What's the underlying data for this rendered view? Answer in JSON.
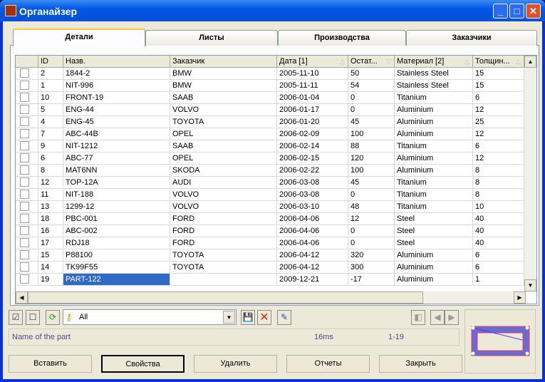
{
  "window": {
    "title": "Органайзер"
  },
  "tabs": [
    "Детали",
    "Листы",
    "Производства",
    "Заказчики"
  ],
  "columns": [
    {
      "label": "ID"
    },
    {
      "label": "Назв."
    },
    {
      "label": "Заказчик"
    },
    {
      "label": "Дата [1]",
      "sort": "asc"
    },
    {
      "label": "Остат...",
      "sort": "desc"
    },
    {
      "label": "Материал [2]",
      "sort": "asc"
    },
    {
      "label": "Толщин...",
      "sort": "asc"
    }
  ],
  "rows": [
    [
      "2",
      "1844-2",
      "BMW",
      "2005-11-10",
      "50",
      "Stainless Steel",
      "15"
    ],
    [
      "1",
      "NIT-996",
      "BMW",
      "2005-11-11",
      "54",
      "Stainless Steel",
      "15"
    ],
    [
      "10",
      "FRONT-19",
      "SAAB",
      "2006-01-04",
      "0",
      "Titanium",
      "6"
    ],
    [
      "5",
      "ENG-44",
      "VOLVO",
      "2006-01-17",
      "0",
      "Aluminium",
      "12"
    ],
    [
      "4",
      "ENG-45",
      "TOYOTA",
      "2006-01-20",
      "45",
      "Aluminium",
      "25"
    ],
    [
      "7",
      "ABC-44B",
      "OPEL",
      "2006-02-09",
      "100",
      "Aluminium",
      "12"
    ],
    [
      "9",
      "NIT-1212",
      "SAAB",
      "2006-02-14",
      "88",
      "Titanium",
      "6"
    ],
    [
      "6",
      "ABC-77",
      "OPEL",
      "2006-02-15",
      "120",
      "Aluminium",
      "12"
    ],
    [
      "8",
      "MAT6NN",
      "SKODA",
      "2006-02-22",
      "100",
      "Aluminium",
      "8"
    ],
    [
      "12",
      "TOP-12A",
      "AUDI",
      "2006-03-08",
      "45",
      "Titanium",
      "8"
    ],
    [
      "11",
      "NIT-188",
      "VOLVO",
      "2006-03-08",
      "0",
      "Titanium",
      "8"
    ],
    [
      "13",
      "1299-12",
      "VOLVO",
      "2006-03-10",
      "48",
      "Titanium",
      "10"
    ],
    [
      "18",
      "PBC-001",
      "FORD",
      "2006-04-06",
      "12",
      "Steel",
      "40"
    ],
    [
      "16",
      "ABC-002",
      "FORD",
      "2006-04-06",
      "0",
      "Steel",
      "40"
    ],
    [
      "17",
      "RDJ18",
      "FORD",
      "2006-04-06",
      "0",
      "Steel",
      "40"
    ],
    [
      "15",
      "P88100",
      "TOYOTA",
      "2006-04-12",
      "320",
      "Aluminium",
      "6"
    ],
    [
      "14",
      "TK99F55",
      "TOYOTA",
      "2006-04-12",
      "300",
      "Aluminium",
      "6"
    ],
    [
      "19",
      "PART-122",
      "",
      "2009-12-21",
      "-17",
      "Aluminium",
      "1"
    ]
  ],
  "filter": {
    "value": "All"
  },
  "status": {
    "hint": "Name of the part",
    "time": "16ms",
    "range": "1-19"
  },
  "buttons": {
    "insert": "Вставить",
    "properties": "Свойства",
    "delete": "Удалить",
    "reports": "Отчеты",
    "close": "Закрыть"
  }
}
